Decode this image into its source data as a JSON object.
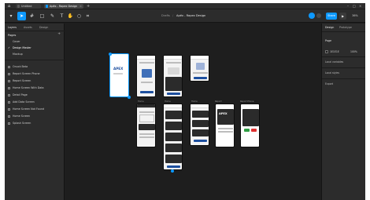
{
  "app": {
    "tabs": [
      {
        "label": "Untitled",
        "icon": "grid-icon",
        "color": "#5b5b5b"
      },
      {
        "label": "Apéx - Rapex Design",
        "icon": "figma-file-icon",
        "color": "#0d99ff"
      }
    ]
  },
  "toolbar": {
    "breadcrumb_left": "Drafts",
    "breadcrumb_sep": "/",
    "breadcrumb_file": "Apéx - Rapex Design",
    "share_label": "Share",
    "play_label": "▶",
    "zoom_label": "36%"
  },
  "left_panel": {
    "tabs": [
      "Layers",
      "Assets",
      "Design"
    ],
    "pages_heading": "Pages",
    "pages": [
      "Cover",
      "Design Master",
      "Mockup"
    ],
    "layers": [
      "Onuck Beta",
      "Report Screen Phone",
      "Report Screen",
      "Home Screen With Data",
      "Detail Page",
      "Add Data Screen",
      "Home Screen Not Found",
      "Home Screen",
      "Splash Screen"
    ]
  },
  "right_panel": {
    "tabs": [
      "Design",
      "Prototype"
    ],
    "page_label": "Page",
    "page_color_hex": "1E1E1E",
    "page_opacity": "100%",
    "local_variables": "Local variables",
    "local_styles": "Local styles",
    "export": "Export"
  },
  "canvas": {
    "brand": "APEX",
    "frame_labels": [
      "Splash",
      "Home",
      "Home",
      "Detail",
      "Report",
      "Add",
      "Home",
      "Home",
      "Report",
      "Report Phone"
    ]
  },
  "colors": {
    "accent": "#0d99ff",
    "brand": "#1d4f9e"
  }
}
